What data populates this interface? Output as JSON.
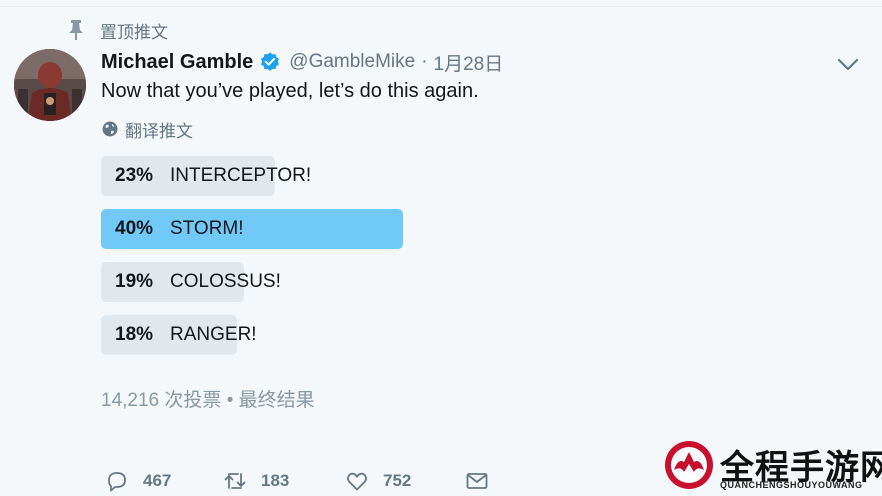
{
  "pinned_label": "置顶推文",
  "tweet": {
    "name": "Michael Gamble",
    "handle": "@GambleMike",
    "separator": "·",
    "time": "1月28日",
    "text": "Now that you’ve played, let’s do this again.",
    "translate_label": "翻译推文"
  },
  "poll": {
    "options": [
      {
        "percent_label": "23%",
        "label": "INTERCEPTOR!",
        "value": 23
      },
      {
        "percent_label": "40%",
        "label": "STORM!",
        "value": 40
      },
      {
        "percent_label": "19%",
        "label": "COLOSSUS!",
        "value": 19
      },
      {
        "percent_label": "18%",
        "label": "RANGER!",
        "value": 18
      }
    ],
    "votes": "14,216 次投票",
    "meta_separator": "•",
    "status": "最终结果"
  },
  "actions": {
    "replies": "467",
    "retweets": "183",
    "likes": "752"
  },
  "watermark": {
    "title": "全程手游网",
    "subtitle": "QUANCHENGSHOUYOUWANG"
  },
  "colors": {
    "accent": "#1da1f2",
    "poll_winner": "#71c9f8",
    "poll_other": "#e1e8ed",
    "muted_text": "#657786"
  }
}
